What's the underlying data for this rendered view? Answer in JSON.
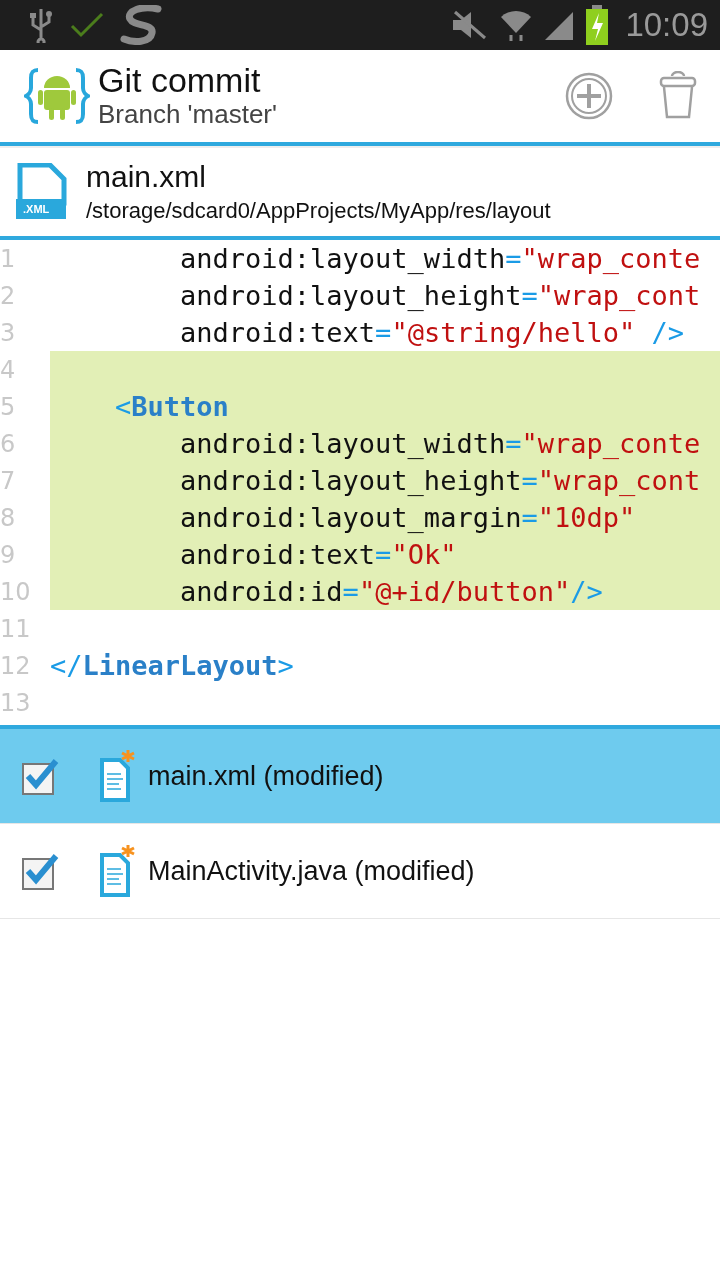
{
  "status_bar": {
    "time": "10:09"
  },
  "action_bar": {
    "title": "Git commit",
    "subtitle": "Branch 'master'"
  },
  "file": {
    "name": "main.xml",
    "icon_label": ".XML",
    "path": "/storage/sdcard0/AppProjects/MyApp/res/layout"
  },
  "code": {
    "lines": [
      {
        "number": "1",
        "highlighted": false,
        "tokens": [
          {
            "kind": "text",
            "text": "        android:layout_width"
          },
          {
            "kind": "punct",
            "text": "="
          },
          {
            "kind": "string",
            "text": "\"wrap_conte"
          }
        ]
      },
      {
        "number": "2",
        "highlighted": false,
        "tokens": [
          {
            "kind": "text",
            "text": "        android:layout_height"
          },
          {
            "kind": "punct",
            "text": "="
          },
          {
            "kind": "string",
            "text": "\"wrap_cont"
          }
        ]
      },
      {
        "number": "3",
        "highlighted": false,
        "tokens": [
          {
            "kind": "text",
            "text": "        android:text"
          },
          {
            "kind": "punct",
            "text": "="
          },
          {
            "kind": "string",
            "text": "\"@string/hello\""
          },
          {
            "kind": "punct",
            "text": " />"
          }
        ]
      },
      {
        "number": "4",
        "highlighted": true
      },
      {
        "number": "5",
        "highlighted": true,
        "tokens": [
          {
            "kind": "punct",
            "text": "    <"
          },
          {
            "kind": "tag",
            "text": "Button"
          }
        ]
      },
      {
        "number": "6",
        "highlighted": true,
        "tokens": [
          {
            "kind": "text",
            "text": "        android:layout_width"
          },
          {
            "kind": "punct",
            "text": "="
          },
          {
            "kind": "string",
            "text": "\"wrap_conte"
          }
        ]
      },
      {
        "number": "7",
        "highlighted": true,
        "tokens": [
          {
            "kind": "text",
            "text": "        android:layout_height"
          },
          {
            "kind": "punct",
            "text": "="
          },
          {
            "kind": "string",
            "text": "\"wrap_cont"
          }
        ]
      },
      {
        "number": "8",
        "highlighted": true,
        "tokens": [
          {
            "kind": "text",
            "text": "        android:layout_margin"
          },
          {
            "kind": "punct",
            "text": "="
          },
          {
            "kind": "string",
            "text": "\"10dp\""
          }
        ]
      },
      {
        "number": "9",
        "highlighted": true,
        "tokens": [
          {
            "kind": "text",
            "text": "        android:text"
          },
          {
            "kind": "punct",
            "text": "="
          },
          {
            "kind": "string",
            "text": "\"Ok\""
          }
        ]
      },
      {
        "number": "10",
        "highlighted": true,
        "tokens": [
          {
            "kind": "text",
            "text": "        android:id"
          },
          {
            "kind": "punct",
            "text": "="
          },
          {
            "kind": "string",
            "text": "\"@+id/button\""
          },
          {
            "kind": "punct",
            "text": "/>"
          }
        ]
      },
      {
        "number": "11",
        "highlighted": false
      },
      {
        "number": "12",
        "highlighted": false,
        "tokens": [
          {
            "kind": "punct",
            "text": "</"
          },
          {
            "kind": "tag",
            "text": "LinearLayout"
          },
          {
            "kind": "punct",
            "text": ">"
          }
        ]
      },
      {
        "number": "13",
        "highlighted": false
      }
    ]
  },
  "changes": [
    {
      "label": "main.xml (modified)",
      "checked": true,
      "selected": true
    },
    {
      "label": "MainActivity.java (modified)",
      "checked": true,
      "selected": false
    }
  ]
}
